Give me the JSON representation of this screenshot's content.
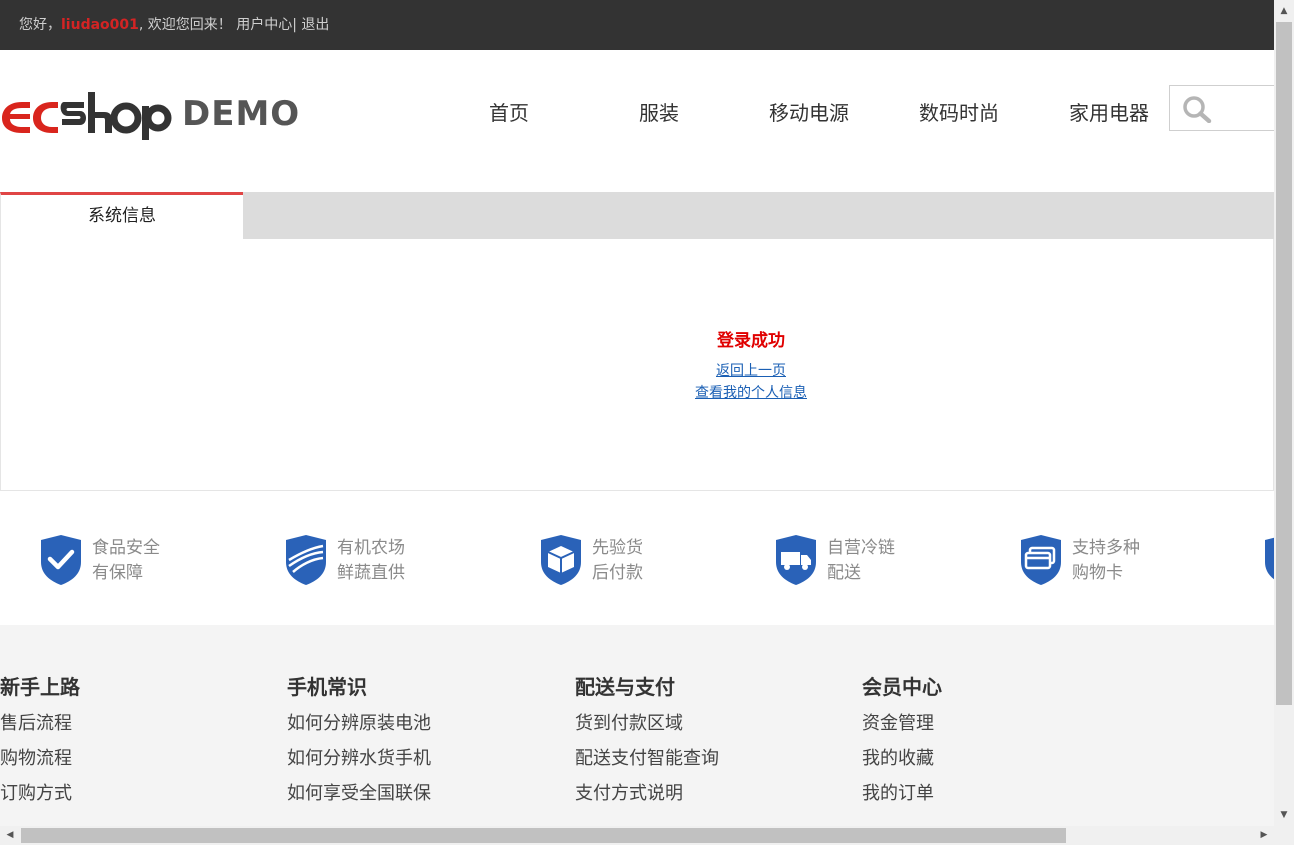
{
  "topbar": {
    "greeting": "您好，",
    "username": "liudao001",
    "welcome": ", 欢迎您回来！",
    "user_center": "用户中心",
    "separator": "|",
    "logout": "退出"
  },
  "logo": {
    "brand_part1": "EC",
    "brand_part2": "SHOP",
    "demo": "DEMO"
  },
  "nav": {
    "items": [
      "首页",
      "服装",
      "移动电源",
      "数码时尚",
      "家用电器"
    ]
  },
  "search": {
    "icon": "search-icon"
  },
  "tabs": {
    "active_label": "系统信息"
  },
  "message": {
    "title": "登录成功",
    "link_back": "返回上一页",
    "link_profile": "查看我的个人信息"
  },
  "services": [
    {
      "icon": "shield-check-icon",
      "line1": "食品安全",
      "line2": "有保障"
    },
    {
      "icon": "shield-farm-icon",
      "line1": "有机农场",
      "line2": "鲜蔬直供"
    },
    {
      "icon": "shield-box-icon",
      "line1": "先验货",
      "line2": "后付款"
    },
    {
      "icon": "shield-truck-icon",
      "line1": "自营冷链",
      "line2": "配送"
    },
    {
      "icon": "shield-card-icon",
      "line1": "支持多种",
      "line2": "购物卡"
    }
  ],
  "footer": {
    "columns": [
      {
        "title": "新手上路",
        "links": [
          "售后流程",
          "购物流程",
          "订购方式"
        ]
      },
      {
        "title": "手机常识",
        "links": [
          "如何分辨原装电池",
          "如何分辨水货手机",
          "如何享受全国联保"
        ]
      },
      {
        "title": "配送与支付",
        "links": [
          "货到付款区域",
          "配送支付智能查询",
          "支付方式说明"
        ]
      },
      {
        "title": "会员中心",
        "links": [
          "资金管理",
          "我的收藏",
          "我的订单"
        ]
      }
    ]
  },
  "colors": {
    "topbar_bg": "#333333",
    "accent_red": "#e00000",
    "link_blue": "#1a5fb4",
    "shield_blue": "#2a62b8",
    "footer_bg": "#f4f4f4"
  }
}
